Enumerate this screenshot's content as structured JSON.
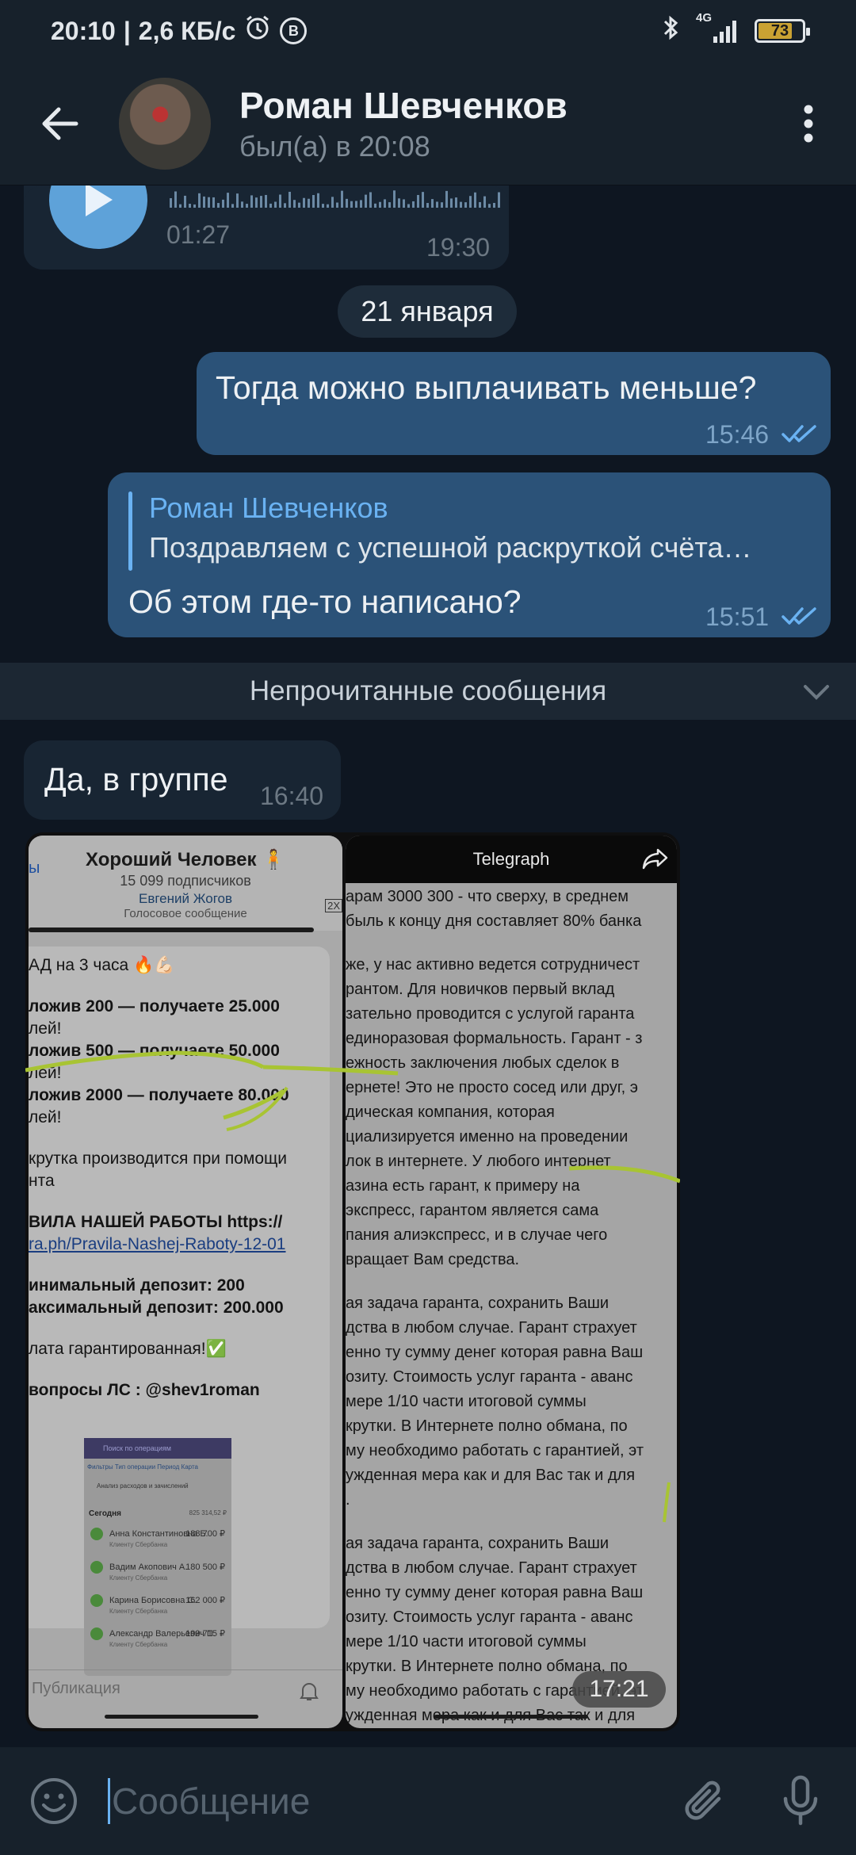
{
  "status_bar": {
    "time": "20:10",
    "separator": "|",
    "speed": "2,6 КБ/с",
    "b_icon_letter": "B",
    "network": "4G",
    "battery": "73",
    "battery_level": 0.73
  },
  "header": {
    "name": "Роман Шевченков",
    "status": "был(а) в 20:08"
  },
  "messages": {
    "voice": {
      "duration": "01:27",
      "time": "19:30"
    },
    "date": "21 января",
    "out1": {
      "text": "Тогда можно выплачивать меньше?",
      "time": "15:46"
    },
    "out2": {
      "reply_author": "Роман Шевченков",
      "reply_text": "Поздравляем с успешной раскруткой счёта…",
      "text": "Об этом где-то написано?",
      "time": "15:51"
    },
    "unread_label": "Непрочитанные сообщения",
    "in1": {
      "text": "Да, в группе",
      "time": "16:40"
    },
    "photo": {
      "time": "17:21",
      "shot1": {
        "back": "ы",
        "channel": "Хороший Человек 🧍",
        "subscribers": "15 099 подписчиков",
        "pinned_name": "Евгений Жогов",
        "pinned_type": "Голосовое сообщение",
        "badge": "2X",
        "lines": [
          "АД на 3 часа 🔥💪🏻",
          "",
          "ложив 200 — получаете 25.000",
          "лей!",
          "ложив 500 — получаете 50.000",
          "лей!",
          "ложив 2000 — получаете 80.000",
          "лей!",
          "",
          "крутка производится при помощи",
          "нта",
          "",
          "ВИЛА НАШЕЙ РАБОТЫ https://",
          "ra.ph/Pravila-Nashej-Raboty-12-01",
          "",
          "инимальный депозит: 200",
          "аксимальный депозит: 200.000",
          "",
          "лата гарантированная!✅",
          "",
          "вопросы ЛС : @shev1roman"
        ],
        "inner_search": "Поиск по операциям",
        "inner_filters": [
          "Фильтры",
          "Тип операции",
          "Период",
          "Карта"
        ],
        "inner_analysis": "Анализ расходов и зачислений",
        "inner_today": "Сегодня",
        "inner_total": "825 314,52 ₽",
        "inner_rows": [
          {
            "name": "Анна Константиновна Б.",
            "sub": "Клиенту Сбербанка",
            "amount": "188 700 ₽"
          },
          {
            "name": "Вадим Акопович А.",
            "sub": "Клиенту Сбербанка",
            "amount": "180 500 ₽"
          },
          {
            "name": "Карина Борисовна С.",
            "sub": "Клиенту Сбербанка",
            "amount": "162 000 ₽"
          },
          {
            "name": "Александр Валерьевич П.",
            "sub": "Клиенту Сбербанка",
            "amount": "199 715 ₽"
          }
        ],
        "input_placeholder": "Публикация"
      },
      "shot2": {
        "title": "Telegraph",
        "lines": [
          "арам 3000 300 - что сверху, в среднем",
          "быль к концу дня составляет 80% банка",
          "",
          "же, у нас активно ведется сотрудничест",
          "рантом. Для новичков первый вклад",
          "зательно проводится с услугой гаранта",
          "единоразовая формальность. Гарант - з",
          "ежность заключения любых сделок в",
          "ернете! Это не просто сосед или друг, э",
          "дическая компания, которая",
          "циализируется именно на проведении",
          "лок в интернете. У любого интернет",
          "азина есть гарант, к примеру на",
          "экспресс, гарантом является сама",
          "пания алиэкспресс, и в случае чего",
          "вращает Вам средства.",
          "",
          "ая задача гаранта, сохранить Ваши",
          "дства в любом случае. Гарант страхует",
          "енно ту сумму денег которая равна Ваш",
          "озиту. Стоимость услуг гаранта - аванс",
          "мере 1/10 части итоговой суммы",
          "крутки. В Интернете полно обмана, по",
          "му необходимо работать с гарантией, эт",
          "ужденная мера как и для Вас так и для",
          ".",
          "",
          "ая задача гаранта, сохранить Ваши",
          "дства в любом случае. Гарант страхует",
          "енно ту сумму денег которая равна Ваш",
          "озиту. Стоимость услуг гаранта - аванс",
          "мере 1/10 части итоговой суммы",
          "крутки. В Интернете полно обмана, по",
          "му необходимо работать с гарантией, эт",
          "ужденная мера как и для Вас так и для"
        ]
      }
    }
  },
  "input": {
    "placeholder": "Сообщение"
  },
  "colors": {
    "background": "#0e1621",
    "header": "#17212b",
    "bubble_in": "#182533",
    "bubble_out": "#2b5278",
    "accent": "#6ab2f2",
    "play": "#5ea2d9"
  }
}
